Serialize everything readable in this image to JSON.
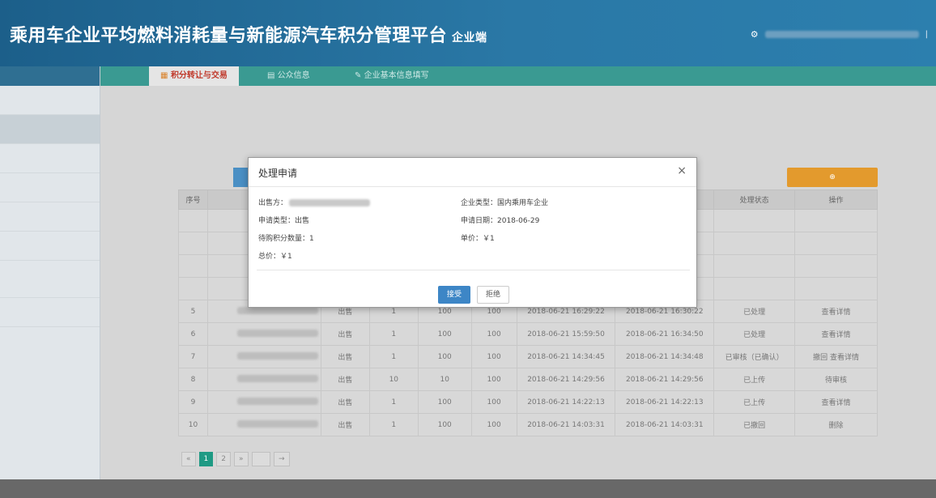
{
  "header": {
    "title": "乘用车企业平均燃料消耗量与新能源汽车积分管理平台",
    "title_suffix": "企业端"
  },
  "tabs": [
    "积分转让与交易",
    "公众信息",
    "企业基本信息填写"
  ],
  "dialog": {
    "title": "处理申请",
    "close": "×",
    "left_fields": [
      {
        "label": "出售方："
      },
      {
        "label": "申请类型：出售"
      },
      {
        "label": "待购积分数量：1"
      },
      {
        "label": "总价：￥1"
      }
    ],
    "right_fields": [
      {
        "label": "企业类型：国内乘用车企业"
      },
      {
        "label": "申请日期：2018-06-29"
      },
      {
        "label": "单价：￥1"
      }
    ],
    "buttons": {
      "confirm": "接受",
      "reject": "拒绝"
    }
  },
  "table": {
    "headers": [
      "序号",
      "",
      "",
      "",
      "",
      "",
      "",
      "",
      "处理状态",
      "操作"
    ],
    "rows": [
      {
        "no": "5",
        "type": "出售",
        "qty": "1",
        "price": "100",
        "total": "100",
        "date1": "2018-06-21 16:29:22",
        "date2": "2018-06-21 16:30:22",
        "status": "已处理",
        "op": "查看详情"
      },
      {
        "no": "6",
        "type": "出售",
        "qty": "1",
        "price": "100",
        "total": "100",
        "date1": "2018-06-21 15:59:50",
        "date2": "2018-06-21 16:34:50",
        "status": "已处理",
        "op": "查看详情"
      },
      {
        "no": "7",
        "type": "出售",
        "qty": "1",
        "price": "100",
        "total": "100",
        "date1": "2018-06-21 14:34:45",
        "date2": "2018-06-21 14:34:48",
        "status": "已审核（已确认）",
        "op": "撤回 查看详情"
      },
      {
        "no": "8",
        "type": "出售",
        "qty": "10",
        "price": "10",
        "total": "100",
        "date1": "2018-06-21 14:29:56",
        "date2": "2018-06-21 14:29:56",
        "status": "已上传",
        "op": "待审核"
      },
      {
        "no": "9",
        "type": "出售",
        "qty": "1",
        "price": "100",
        "total": "100",
        "date1": "2018-06-21 14:22:13",
        "date2": "2018-06-21 14:22:13",
        "status": "已上传",
        "op": "查看详情"
      },
      {
        "no": "10",
        "type": "出售",
        "qty": "1",
        "price": "100",
        "total": "100",
        "date1": "2018-06-21 14:03:31",
        "date2": "2018-06-21 14:03:31",
        "status": "已撤回",
        "op": "删除"
      }
    ]
  }
}
